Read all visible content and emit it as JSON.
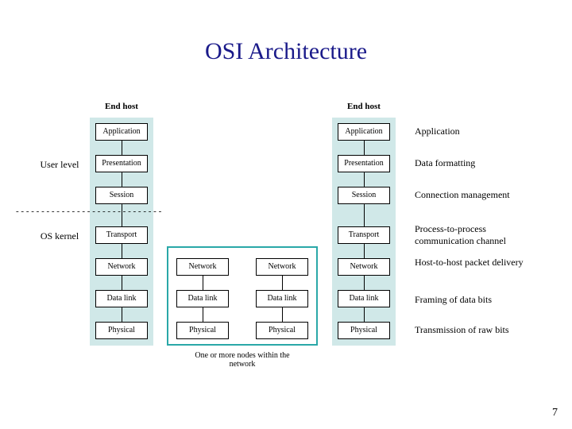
{
  "title": "OSI Architecture",
  "hostLabels": {
    "left": "End host",
    "right": "End host"
  },
  "layers": [
    "Application",
    "Presentation",
    "Session",
    "Transport",
    "Network",
    "Data link",
    "Physical"
  ],
  "midLayers": [
    "Network",
    "Data link",
    "Physical"
  ],
  "levelLabels": {
    "user": "User level",
    "os": "OS kernel"
  },
  "desc": {
    "application": "Application",
    "presentation": "Data formatting",
    "session": "Connection management",
    "transport": "Process-to-process communication channel",
    "network": "Host-to-host packet delivery",
    "datalink": "Framing of data bits",
    "physical": "Transmission of raw bits"
  },
  "midCaption": "One or more nodes within the network",
  "pageNumber": "7"
}
